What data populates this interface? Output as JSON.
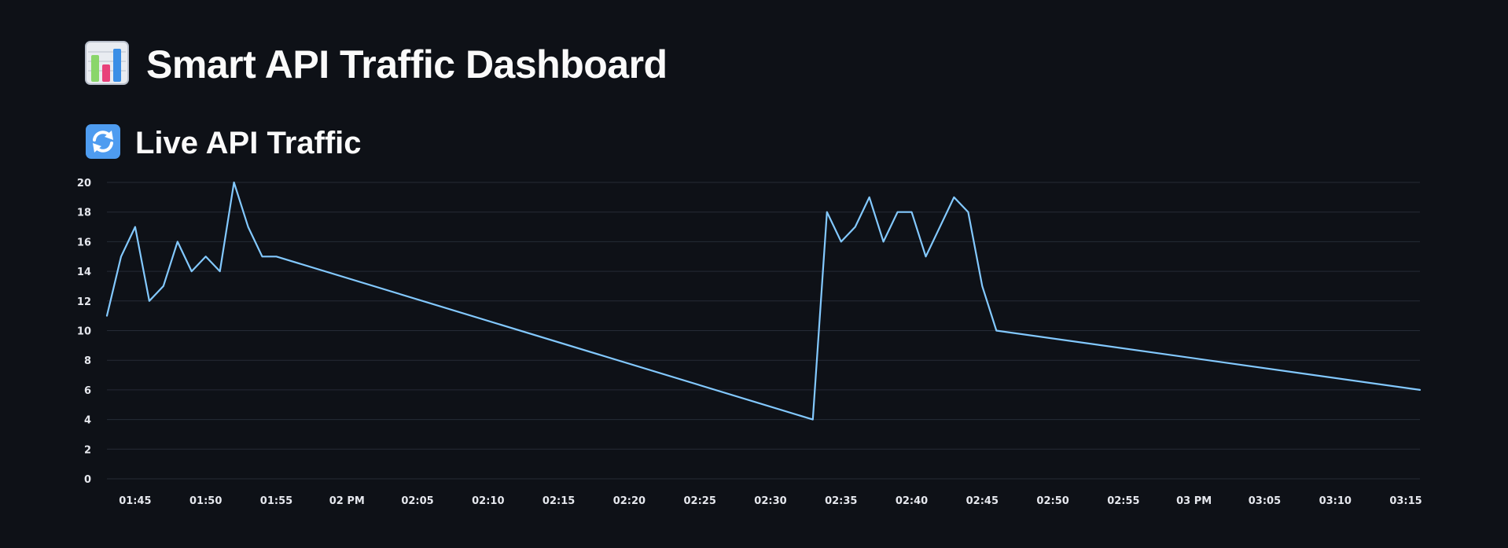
{
  "header": {
    "title": "Smart API Traffic Dashboard",
    "title_icon": "bar-chart-icon"
  },
  "section": {
    "title": "Live API Traffic",
    "title_icon": "refresh-arrows-icon"
  },
  "colors": {
    "background": "#0e1117",
    "line": "#83c9ff",
    "grid": "#262b36",
    "text": "#fafafa"
  },
  "chart_data": {
    "type": "line",
    "title": "",
    "xlabel": "",
    "ylabel": "",
    "ylim": [
      0,
      20
    ],
    "y_ticks": [
      "0",
      "2",
      "4",
      "6",
      "8",
      "10",
      "12",
      "14",
      "16",
      "18",
      "20"
    ],
    "xlim": [
      "01:43",
      "03:16"
    ],
    "x_ticks": [
      {
        "time": "01:45",
        "label": "01:45"
      },
      {
        "time": "01:50",
        "label": "01:50"
      },
      {
        "time": "01:55",
        "label": "01:55"
      },
      {
        "time": "02:00",
        "label": "02 PM"
      },
      {
        "time": "02:05",
        "label": "02:05"
      },
      {
        "time": "02:10",
        "label": "02:10"
      },
      {
        "time": "02:15",
        "label": "02:15"
      },
      {
        "time": "02:20",
        "label": "02:20"
      },
      {
        "time": "02:25",
        "label": "02:25"
      },
      {
        "time": "02:30",
        "label": "02:30"
      },
      {
        "time": "02:35",
        "label": "02:35"
      },
      {
        "time": "02:40",
        "label": "02:40"
      },
      {
        "time": "02:45",
        "label": "02:45"
      },
      {
        "time": "02:50",
        "label": "02:50"
      },
      {
        "time": "02:55",
        "label": "02:55"
      },
      {
        "time": "03:00",
        "label": "03 PM"
      },
      {
        "time": "03:05",
        "label": "03:05"
      },
      {
        "time": "03:10",
        "label": "03:10"
      },
      {
        "time": "03:15",
        "label": "03:15"
      }
    ],
    "grid": true,
    "legend": "none",
    "series": [
      {
        "x": [
          "01:43",
          "01:44",
          "01:45",
          "01:46",
          "01:47",
          "01:48",
          "01:49",
          "01:50",
          "01:51",
          "01:52",
          "01:53",
          "01:54",
          "01:55",
          "02:33",
          "02:34",
          "02:35",
          "02:36",
          "02:37",
          "02:38",
          "02:39",
          "02:40",
          "02:41",
          "02:43",
          "02:44",
          "02:45",
          "02:46",
          "03:16"
        ],
        "values": [
          11,
          15,
          17,
          12,
          13,
          16,
          14,
          15,
          14,
          20,
          17,
          15,
          15,
          4,
          18,
          16,
          17,
          19,
          16,
          18,
          18,
          15,
          19,
          18,
          13,
          10,
          6
        ]
      }
    ]
  }
}
